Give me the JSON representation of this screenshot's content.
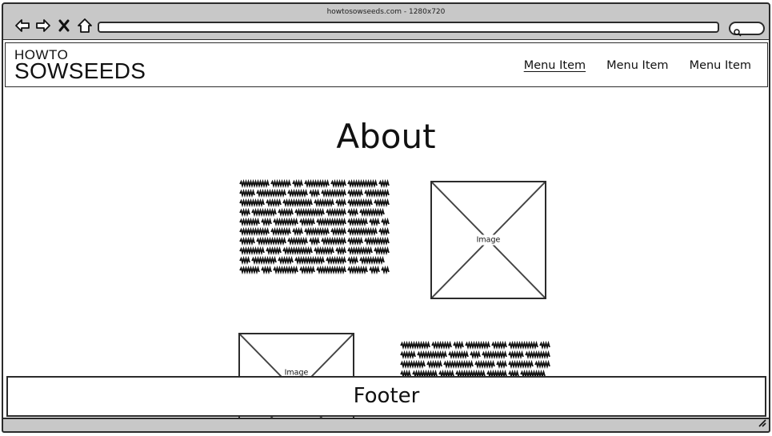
{
  "browser": {
    "title": "howtosowseeds.com - 1280x720",
    "address": "",
    "icons": [
      "back-arrow-icon",
      "forward-arrow-icon",
      "close-icon",
      "home-icon",
      "search-icon"
    ]
  },
  "header": {
    "logo_line1": "HOWTO",
    "logo_line2": "SOWSEEDS",
    "menu": [
      {
        "label": "Menu Item",
        "active": true
      },
      {
        "label": "Menu Item",
        "active": false
      },
      {
        "label": "Menu Item",
        "active": false
      }
    ]
  },
  "main": {
    "title": "About",
    "image1_label": "Image",
    "image2_label": "Image"
  },
  "footer": {
    "label": "Footer"
  },
  "colors": {
    "chrome": "#c8c8c8",
    "stroke": "#2b2b2b",
    "background": "#ffffff"
  }
}
